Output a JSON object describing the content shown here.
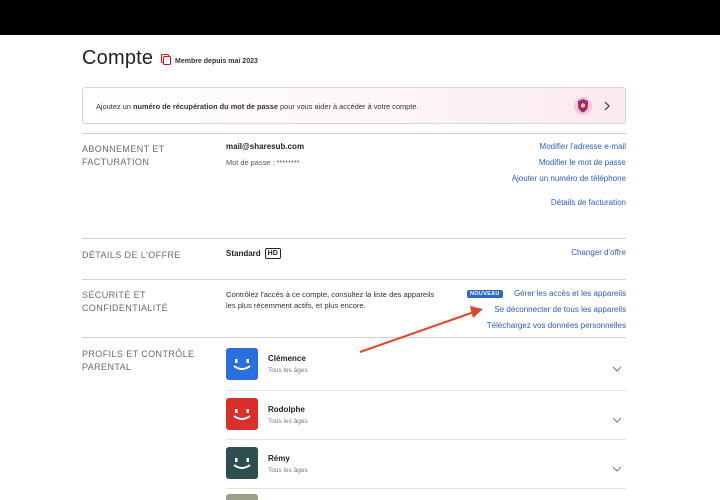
{
  "page": {
    "title": "Compte",
    "member_since": "Membre depuis mai 2023"
  },
  "banner": {
    "text_before": "Ajoutez un ",
    "text_bold": "numéro de récupération du mot de passe",
    "text_after": " pour vous aider à accéder à votre compte."
  },
  "billing": {
    "label": "ABONNEMENT ET FACTURATION",
    "email": "mail@sharesub.com",
    "password": "Mot de passe : ********",
    "links": {
      "change_email": "Modifier l'adresse e-mail",
      "change_password": "Modifier le mot de passe",
      "add_phone": "Ajouter un numéro de téléphone",
      "billing_details": "Détails de facturation"
    }
  },
  "plan": {
    "label": "DÉTAILS DE L'OFFRE",
    "name": "Standard",
    "badge": "HD",
    "change_link": "Changer d'offre"
  },
  "security": {
    "label": "SÉCURITÉ ET CONFIDENTIALITÉ",
    "description": "Contrôlez l'accès à ce compte, consultez la liste des appareils les plus récemment actifs, et plus encore.",
    "new_badge": "NOUVEAU",
    "links": {
      "manage_access": "Gérer les accès et les appareils",
      "sign_out_all": "Se déconnecter de tous les appareils",
      "download_data": "Téléchargez vos données personnelles"
    }
  },
  "profiles": {
    "label": "PROFILS ET CONTRÔLE PARENTAL",
    "items": [
      {
        "name": "Clémence",
        "rating": "Tous les âges",
        "color": "#2b6ee0"
      },
      {
        "name": "Rodolphe",
        "rating": "Tous les âges",
        "color": "#d9302c"
      },
      {
        "name": "Rémy",
        "rating": "Tous les âges",
        "color": "#2e4f52"
      }
    ]
  },
  "colors": {
    "link": "#2a5ebd",
    "annotation_arrow": "#e0442b",
    "badge_new": "#2f6ac8"
  }
}
